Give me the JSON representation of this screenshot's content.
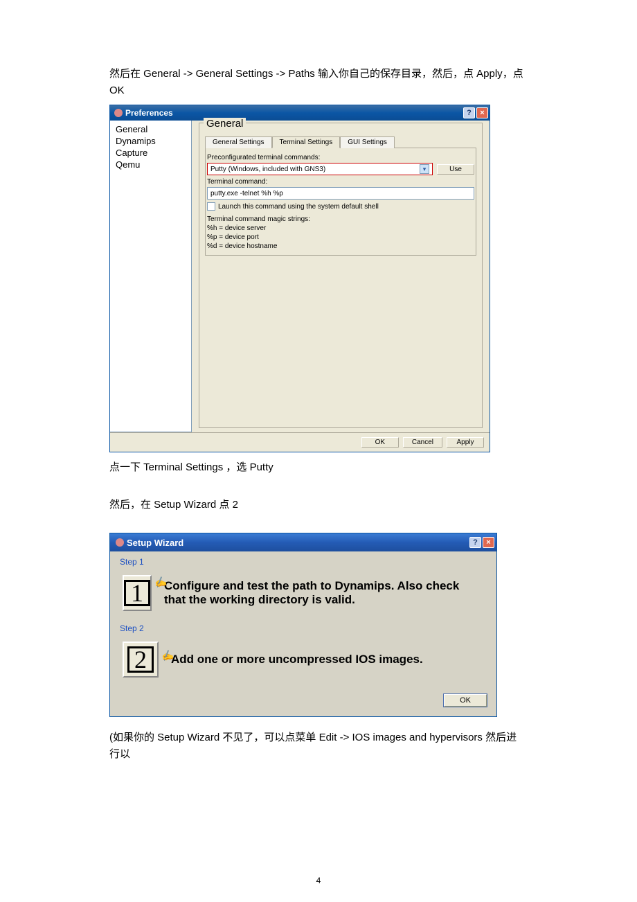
{
  "instructions": {
    "line1_pre": "然后在 ",
    "line1_path": "General -> General Settings -> Paths",
    "line1_mid": " 输入你自己的保存目录，然后，点 ",
    "line1_apply": "Apply",
    "line1_sep": "，点 ",
    "line1_ok": "OK",
    "line2_pre": "点一下 ",
    "line2_a": "Terminal Settings",
    "line2_mid": " ，选 ",
    "line2_b": "Putty",
    "line3_pre": "然后，在 ",
    "line3_a": "Setup Wizard",
    "line3_mid": " 点 ",
    "line3_b": "2",
    "line4_pre": "(如果你的 ",
    "line4_a": "Setup Wizard",
    "line4_mid": " 不见了，可以点菜单 ",
    "line4_b": "Edit -> IOS images and hypervisors",
    "line4_post": " 然后进行以"
  },
  "preferences": {
    "title": "Preferences",
    "sidebar": {
      "items": [
        "General",
        "Dynamips",
        "Capture",
        "Qemu"
      ]
    },
    "group_title": "General",
    "tabs": [
      "General Settings",
      "Terminal Settings",
      "GUI Settings"
    ],
    "active_tab": 1,
    "preconf_label": "Preconfigurated terminal commands:",
    "preconf_value": "Putty (Windows, included with GNS3)",
    "use_button": "Use",
    "term_cmd_label": "Terminal command:",
    "term_cmd_value": "putty.exe -telnet %h %p",
    "launch_checkbox": "Launch this command using the system default shell",
    "magic_title": "Terminal command magic strings:",
    "magic_lines": [
      "%h = device server",
      "%p = device port",
      "%d = device hostname"
    ],
    "buttons": {
      "ok": "OK",
      "cancel": "Cancel",
      "apply": "Apply"
    }
  },
  "wizard": {
    "title": "Setup Wizard",
    "step1_label": "Step 1",
    "step1_num": "1",
    "step1_text": "Configure and test the path to Dynamips. Also check that the working directory is valid.",
    "step2_label": "Step 2",
    "step2_num": "2",
    "step2_text": "Add one or more uncompressed IOS images.",
    "ok": "OK"
  },
  "page_number": "4",
  "titlebar_help": "?",
  "titlebar_close": "×"
}
